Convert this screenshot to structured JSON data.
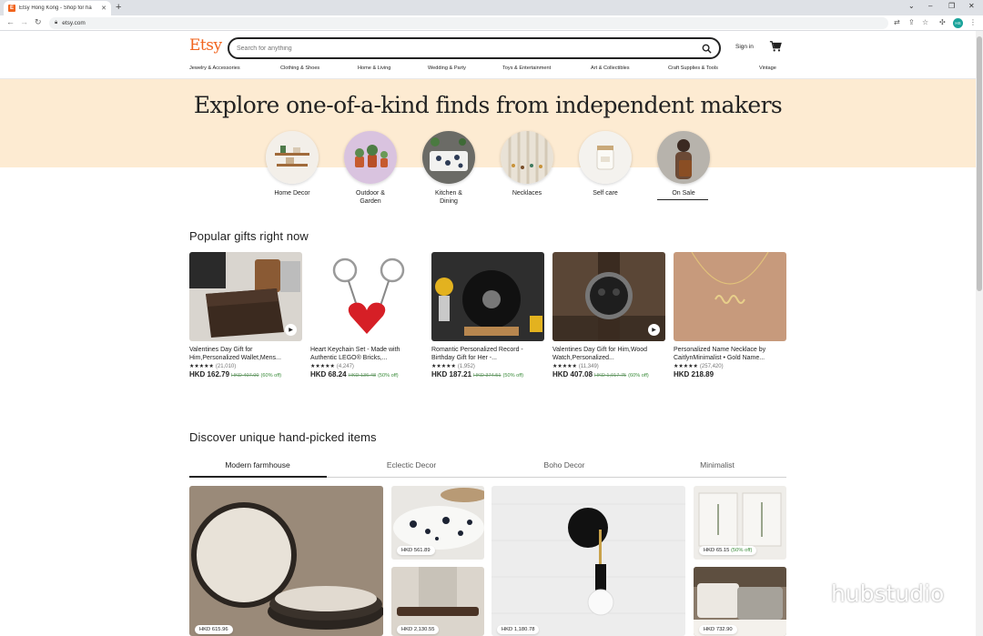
{
  "browser": {
    "tab_title": "Etsy Hong Kong - Shop for ha",
    "tab_favicon": "E",
    "tab_close": "✕",
    "new_tab": "+",
    "url": "etsy.com",
    "profile_initials": "HS",
    "window_controls": [
      "⌄",
      "–",
      "❐",
      "✕"
    ],
    "toolbar_icons": [
      "translate-icon",
      "share-icon",
      "star-icon",
      "extensions-icon",
      "menu-icon"
    ]
  },
  "header": {
    "logo": "Etsy",
    "search_placeholder": "Search for anything",
    "sign_in": "Sign in",
    "categories": [
      "Jewelry & Accessories",
      "Clothing & Shoes",
      "Home & Living",
      "Wedding & Party",
      "Toys & Entertainment",
      "Art & Collectibles",
      "Craft Supplies & Tools",
      "Vintage"
    ]
  },
  "hero": {
    "title": "Explore one-of-a-kind finds from independent makers",
    "circles": [
      {
        "label": "Home Decor"
      },
      {
        "label": "Outdoor & Garden"
      },
      {
        "label": "Kitchen & Dining"
      },
      {
        "label": "Necklaces"
      },
      {
        "label": "Self care"
      },
      {
        "label": "On Sale"
      }
    ]
  },
  "popular": {
    "title": "Popular gifts right now",
    "items": [
      {
        "title": "Valentines Day Gift for Him,Personalized Wallet,Mens...",
        "stars": "★★★★★",
        "count": "(21,010)",
        "price": "HKD 162.79",
        "orig": "HKD 407.00",
        "off": "(60% off)",
        "video": true
      },
      {
        "title": "Heart Keychain Set - Made with Authentic LEGO® Bricks,...",
        "stars": "★★★★★",
        "count": "(4,247)",
        "price": "HKD 68.24",
        "orig": "HKD 136.48",
        "off": "(50% off)",
        "video": false
      },
      {
        "title": "Romantic Personalized Record - Birthday Gift for Her -...",
        "stars": "★★★★★",
        "count": "(1,952)",
        "price": "HKD 187.21",
        "orig": "HKD 374.51",
        "off": "(50% off)",
        "video": false
      },
      {
        "title": "Valentines Day Gift for Him,Wood Watch,Personalized...",
        "stars": "★★★★★",
        "count": "(11,349)",
        "price": "HKD 407.08",
        "orig": "HKD 1,017.75",
        "off": "(60% off)",
        "video": true
      },
      {
        "title": "Personalized Name Necklace by CaitlynMinimalist • Gold Name...",
        "stars": "★★★★★",
        "count": "(257,420)",
        "price": "HKD 218.89",
        "orig": "",
        "off": "",
        "video": false
      }
    ]
  },
  "discover": {
    "title": "Discover unique hand-picked items",
    "tabs": [
      "Modern farmhouse",
      "Eclectic Decor",
      "Boho Decor",
      "Minimalist"
    ],
    "prices": {
      "plates": "HKD 615.96",
      "dish": "HKD 561.89",
      "tray": "HKD 2,130.55",
      "lamp": "HKD 1,180.78",
      "prints_price": "HKD 65.15",
      "prints_off": "(50% off)",
      "pillows": "HKD 732.90"
    }
  },
  "watermark": {
    "text": "hubstudio"
  }
}
